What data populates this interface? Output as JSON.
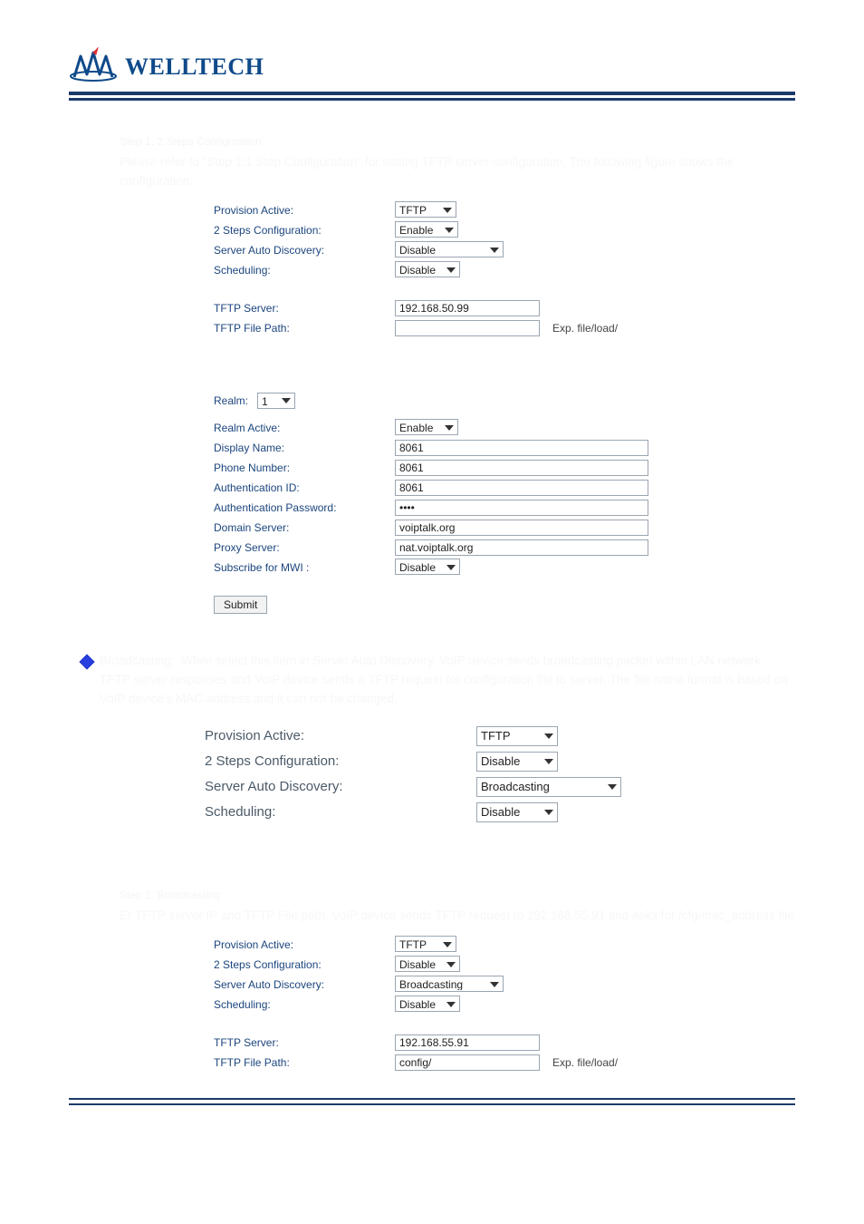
{
  "brand": {
    "name": "WELLTECH"
  },
  "doc": {
    "step1_note": "Step 1: 2 Steps Configuration",
    "step1_body": "Please refer to \"Step 1:1 Step Configuration\" for setting TFTP server configuration. The following figure shows the configuration.",
    "broadcasting_title": "Broadcasting:",
    "broadcasting_body": "While select this item in Server Auto Discovery, VoIP device sends broadcasting packet within LAN network. TFTP server responses and VoIP device sends a TFTP request for configuration file to server. The file name format is based on VoIP device's MAC address and it can not be changed.",
    "step2_note": "Step 2: Broadcasting",
    "step2_body": "Er TFTP server IP and TFTP File path. VoIP device sends TFTP request to 192.168.55.91 and asks for /cfg/mac_address file."
  },
  "panelA": {
    "labels": {
      "provision_active": "Provision Active:",
      "two_steps": "2 Steps Configuration:",
      "auto_discovery": "Server Auto Discovery:",
      "scheduling": "Scheduling:",
      "tftp_server": "TFTP Server:",
      "tftp_path": "TFTP File Path:",
      "realm": "Realm:",
      "realm_active": "Realm Active:",
      "display_name": "Display Name:",
      "phone_number": "Phone Number:",
      "auth_id": "Authentication ID:",
      "auth_pw": "Authentication Password:",
      "domain_server": "Domain Server:",
      "proxy_server": "Proxy Server:",
      "subscribe_mwi": "Subscribe for MWI :",
      "submit": "Submit",
      "hint": "Exp. file/load/"
    },
    "values": {
      "provision_active": "TFTP",
      "two_steps": "Enable",
      "auto_discovery": "Disable",
      "scheduling": "Disable",
      "tftp_server": "192.168.50.99",
      "tftp_path": "",
      "realm": "1",
      "realm_active": "Enable",
      "display_name": "8061",
      "phone_number": "8061",
      "auth_id": "8061",
      "auth_pw": "••••",
      "domain_server": "voiptalk.org",
      "proxy_server": "nat.voiptalk.org",
      "subscribe_mwi": "Disable"
    }
  },
  "panelB": {
    "labels": {
      "provision_active": "Provision Active:",
      "two_steps": "2 Steps Configuration:",
      "auto_discovery": "Server Auto Discovery:",
      "scheduling": "Scheduling:"
    },
    "values": {
      "provision_active": "TFTP",
      "two_steps": "Disable",
      "auto_discovery": "Broadcasting",
      "scheduling": "Disable"
    }
  },
  "panelC": {
    "labels": {
      "provision_active": "Provision Active:",
      "two_steps": "2 Steps Configuration:",
      "auto_discovery": "Server Auto Discovery:",
      "scheduling": "Scheduling:",
      "tftp_server": "TFTP Server:",
      "tftp_path": "TFTP File Path:",
      "hint": "Exp. file/load/"
    },
    "values": {
      "provision_active": "TFTP",
      "two_steps": "Disable",
      "auto_discovery": "Broadcasting",
      "scheduling": "Disable",
      "tftp_server": "192.168.55.91",
      "tftp_path": "config/"
    }
  }
}
